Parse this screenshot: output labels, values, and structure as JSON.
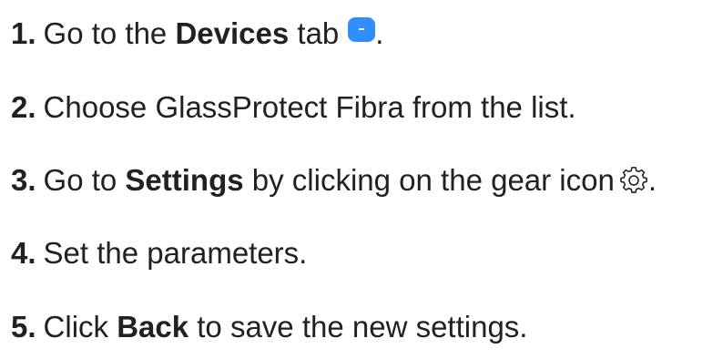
{
  "steps": [
    {
      "number": "1.",
      "before": "Go to the",
      "bold": "Devices",
      "after": "tab",
      "end": "."
    },
    {
      "number": "2.",
      "text": "Choose GlassProtect Fibra from the list."
    },
    {
      "number": "3.",
      "before": "Go to",
      "bold": "Settings",
      "after": "by clicking on the gear icon",
      "end": "."
    },
    {
      "number": "4.",
      "text": "Set the parameters."
    },
    {
      "number": "5.",
      "before": "Click",
      "bold": "Back",
      "after": "to save the new settings."
    }
  ],
  "icons": {
    "devices_tab": "devices-tab-icon",
    "gear": "gear-icon"
  },
  "colors": {
    "text": "#212121",
    "accent": "#2f8fff"
  }
}
